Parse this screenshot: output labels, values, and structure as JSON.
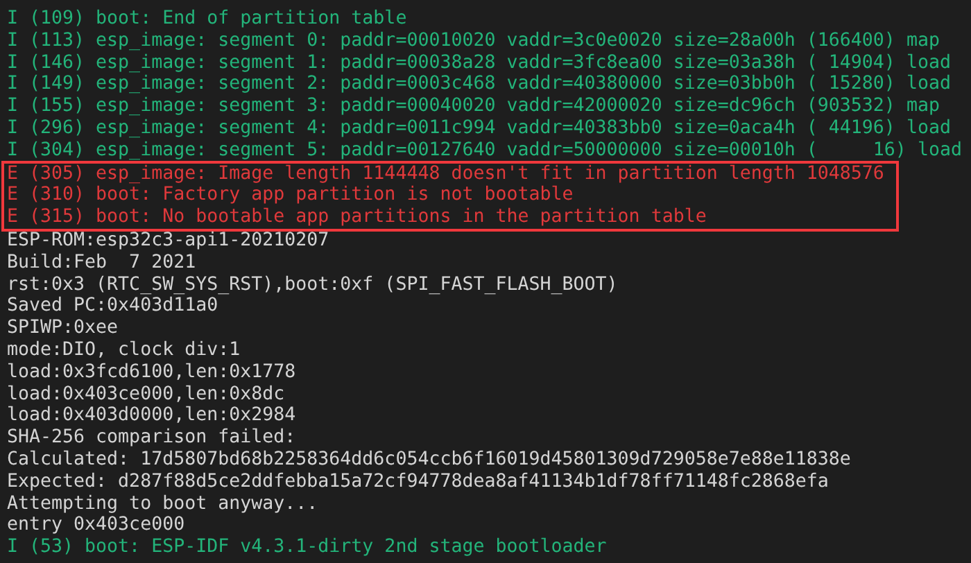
{
  "terminal": {
    "lines_before": [
      {
        "kind": "info",
        "text": "I (109) boot: End of partition table"
      },
      {
        "kind": "info",
        "text": "I (113) esp_image: segment 0: paddr=00010020 vaddr=3c0e0020 size=28a00h (166400) map"
      },
      {
        "kind": "info",
        "text": "I (146) esp_image: segment 1: paddr=00038a28 vaddr=3fc8ea00 size=03a38h ( 14904) load"
      },
      {
        "kind": "info",
        "text": "I (149) esp_image: segment 2: paddr=0003c468 vaddr=40380000 size=03bb0h ( 15280) load"
      },
      {
        "kind": "info",
        "text": "I (155) esp_image: segment 3: paddr=00040020 vaddr=42000020 size=dc96ch (903532) map"
      },
      {
        "kind": "info",
        "text": "I (296) esp_image: segment 4: paddr=0011c994 vaddr=40383bb0 size=0aca4h ( 44196) load"
      },
      {
        "kind": "info",
        "text": "I (304) esp_image: segment 5: paddr=00127640 vaddr=50000000 size=00010h (     16) load"
      }
    ],
    "highlighted_lines": [
      {
        "kind": "error",
        "text": "E (305) esp_image: Image length 1144448 doesn't fit in partition length 1048576"
      },
      {
        "kind": "error",
        "text": "E (310) boot: Factory app partition is not bootable"
      },
      {
        "kind": "error",
        "text": "E (315) boot: No bootable app partitions in the partition table"
      }
    ],
    "lines_after": [
      {
        "kind": "plain",
        "text": "ESP-ROM:esp32c3-api1-20210207"
      },
      {
        "kind": "plain",
        "text": "Build:Feb  7 2021"
      },
      {
        "kind": "plain",
        "text": "rst:0x3 (RTC_SW_SYS_RST),boot:0xf (SPI_FAST_FLASH_BOOT)"
      },
      {
        "kind": "plain",
        "text": "Saved PC:0x403d11a0"
      },
      {
        "kind": "plain",
        "text": "SPIWP:0xee"
      },
      {
        "kind": "plain",
        "text": "mode:DIO, clock div:1"
      },
      {
        "kind": "plain",
        "text": "load:0x3fcd6100,len:0x1778"
      },
      {
        "kind": "plain",
        "text": "load:0x403ce000,len:0x8dc"
      },
      {
        "kind": "plain",
        "text": "load:0x403d0000,len:0x2984"
      },
      {
        "kind": "plain",
        "text": "SHA-256 comparison failed:"
      },
      {
        "kind": "plain",
        "text": "Calculated: 17d5807bd68b2258364dd6c054ccb6f16019d45801309d729058e7e88e11838e"
      },
      {
        "kind": "plain",
        "text": "Expected: d287f88d5ce2ddfebba15a72cf94778dea8af41134b1df78ff71148fc2868efa"
      },
      {
        "kind": "plain",
        "text": "Attempting to boot anyway..."
      },
      {
        "kind": "plain",
        "text": "entry 0x403ce000"
      },
      {
        "kind": "info",
        "text": "I (53) boot: ESP-IDF v4.3.1-dirty 2nd stage bootloader"
      }
    ]
  }
}
